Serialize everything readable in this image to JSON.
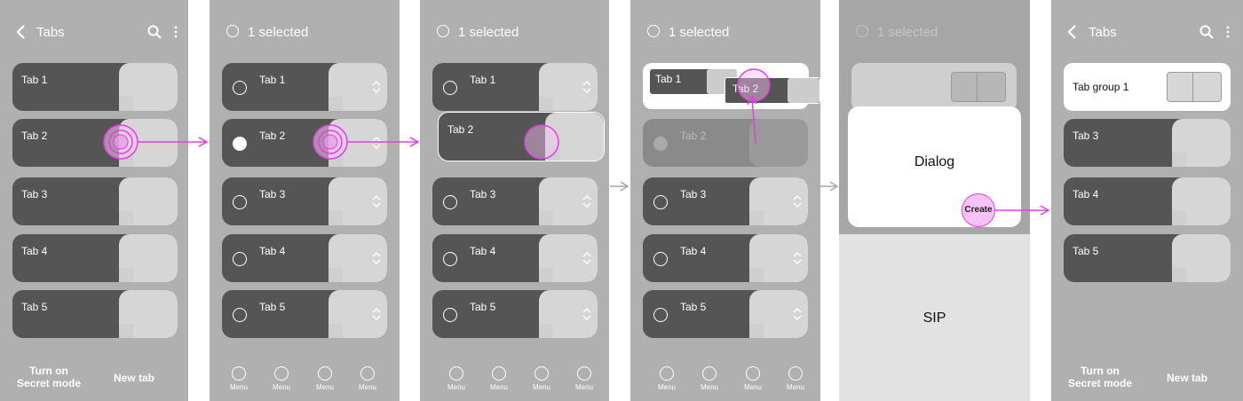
{
  "screen1": {
    "title": "Tabs",
    "tabs": [
      "Tab 1",
      "Tab 2",
      "Tab 3",
      "Tab 4",
      "Tab 5"
    ],
    "bottom_left": "Turn on\nSecret mode",
    "bottom_right": "New tab"
  },
  "screen2": {
    "header": "1 selected",
    "tabs": [
      "Tab 1",
      "Tab 2",
      "Tab 3",
      "Tab 4",
      "Tab 5"
    ],
    "menu": [
      "Menu",
      "Menu",
      "Menu",
      "Menu"
    ]
  },
  "screen3": {
    "header": "1 selected",
    "tabs": [
      "Tab 1",
      "Tab 2",
      "Tab 3",
      "Tab 4",
      "Tab 5"
    ],
    "menu": [
      "Menu",
      "Menu",
      "Menu",
      "Menu"
    ]
  },
  "screen4": {
    "header": "1 selected",
    "tabs": [
      "Tab 1",
      "Tab 2",
      "Tab 2",
      "Tab 3",
      "Tab 4",
      "Tab 5"
    ],
    "menu": [
      "Menu",
      "Menu",
      "Menu",
      "Menu"
    ]
  },
  "screen5": {
    "header": "1 selected",
    "dialog": "Dialog",
    "create": "Create",
    "sip": "SIP"
  },
  "screen6": {
    "title": "Tabs",
    "group": "Tab group 1",
    "tabs": [
      "Tab 3",
      "Tab 4",
      "Tab 5"
    ],
    "bottom_left": "Turn on\nSecret mode",
    "bottom_right": "New tab"
  },
  "colors": {
    "screen_bg": "#b0b0b0",
    "card": "#555555",
    "thumb": "#d6d6d6",
    "touch": "#e040e0"
  }
}
